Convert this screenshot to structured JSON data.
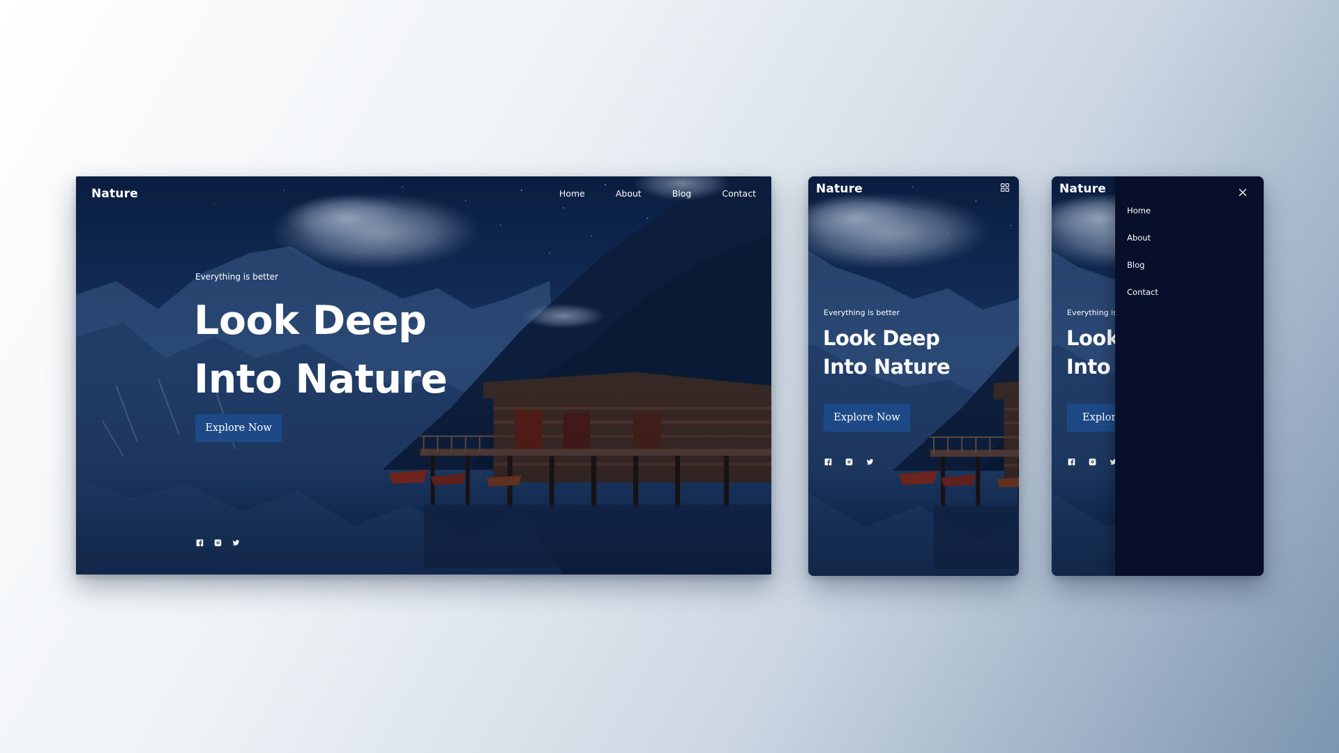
{
  "brand": {
    "name": "Nature"
  },
  "nav": {
    "items": [
      "Home",
      "About",
      "Blog",
      "Contact"
    ]
  },
  "hero": {
    "eyebrow": "Everything is better",
    "headline_line1": "Look Deep",
    "headline_line2": "Into Nature",
    "cta_label": "Explore Now"
  },
  "social": {
    "icons": [
      "facebook-icon",
      "instagram-icon",
      "twitter-icon"
    ]
  },
  "mobile": {
    "menu_toggle_icon": "grid-icon",
    "close_icon": "close-icon"
  },
  "colors": {
    "cta_background": "#1d4a86",
    "drawer_background": "#070f2a",
    "scene_sky": "#0e2345",
    "text": "#ffffff"
  }
}
